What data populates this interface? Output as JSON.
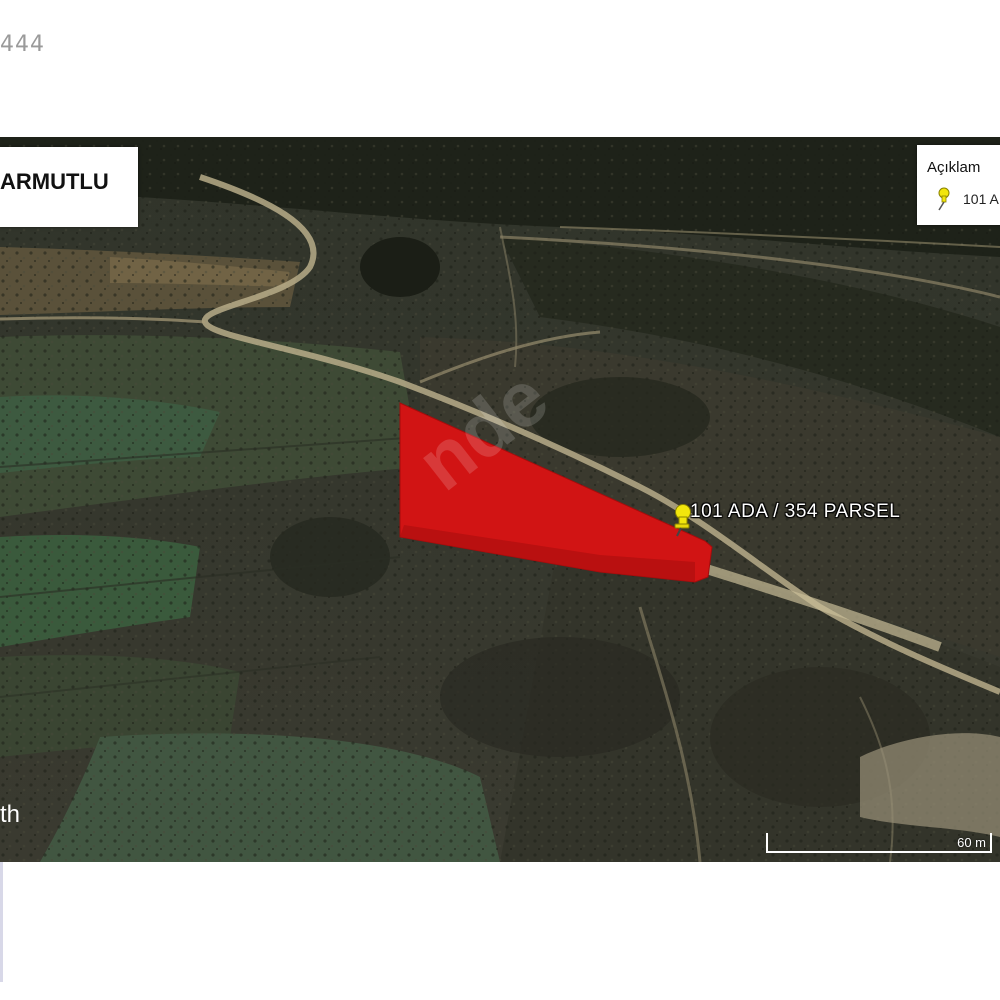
{
  "listing": {
    "id_fragment": "444"
  },
  "map": {
    "type": "satellite-3d",
    "place_name": "ARMUTLU",
    "legend": {
      "title": "Açıklam",
      "item_label": "101 A",
      "item_icon": "yellow-pushpin-icon"
    },
    "parcel": {
      "label": "101 ADA / 354 PARSEL",
      "fill_color": "#d11414",
      "pin_icon": "yellow-pushpin-icon",
      "pin_color": "#f2e60c"
    },
    "watermark": "nde",
    "attribution": "th",
    "scale": {
      "label": "60 m"
    }
  }
}
